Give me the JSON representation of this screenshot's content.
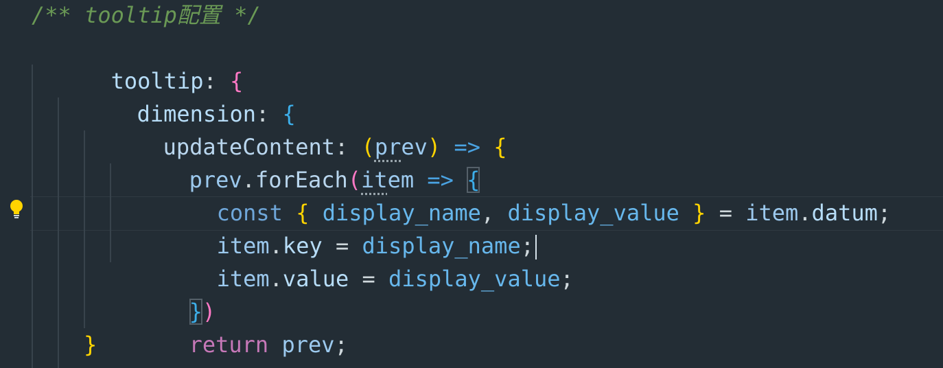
{
  "editor": {
    "lines": [
      "/** tooltip配置 */",
      "tooltip: {",
      "dimension: {",
      "updateContent: (prev) => {",
      "prev.forEach(item => {",
      "const { display_name, display_value } = item.datum;",
      "item.key = display_name;",
      "item.value = display_value;",
      "})",
      "return prev;",
      "}"
    ],
    "icons": {
      "lightbulb": "lightbulb-icon"
    }
  }
}
